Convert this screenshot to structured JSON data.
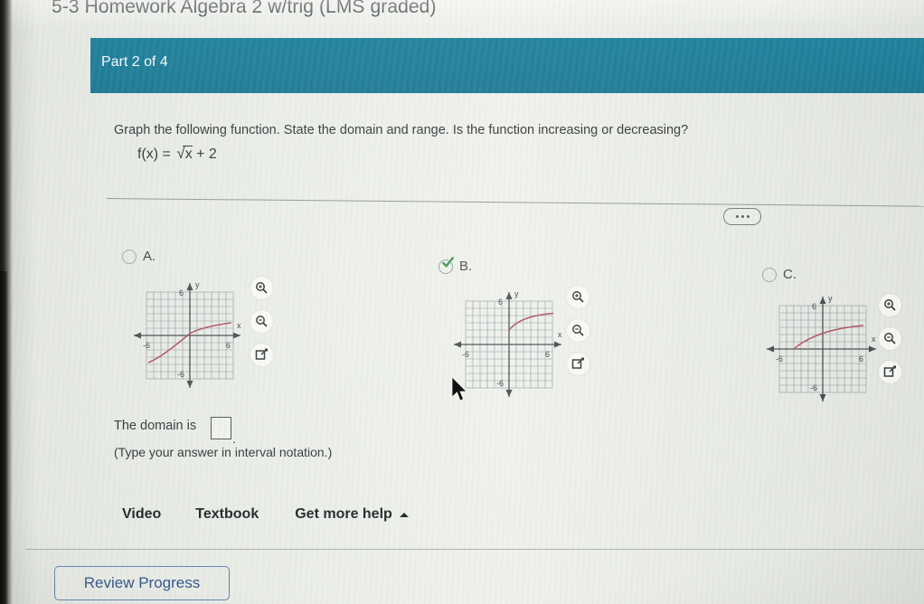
{
  "header": {
    "assignment_title": "5-3 Homework Algebra 2 w/trig (LMS graded)",
    "part_label": "Part 2 of 4"
  },
  "question": {
    "prompt": "Graph the following function. State the domain and range. Is the function increasing or decreasing?",
    "function_prefix": "f(x) =",
    "function_radicand": "x",
    "function_suffix": "+ 2",
    "more_options_icon": "ellipsis-icon"
  },
  "options": [
    {
      "id": "A",
      "label": "A.",
      "selected": false,
      "graph": {
        "x_axis_label": "x",
        "y_axis_label": "y",
        "x_max_tick": "6",
        "x_min_tick": "-6",
        "y_max_tick": "6",
        "y_min_tick": "-6",
        "curve_type": "cube-root-increasing"
      },
      "tools": [
        "zoom-in-icon",
        "zoom-out-icon",
        "expand-icon"
      ]
    },
    {
      "id": "B",
      "label": "B.",
      "selected": true,
      "graph": {
        "x_axis_label": "x",
        "y_axis_label": "y",
        "x_max_tick": "6",
        "x_min_tick": "-6",
        "y_max_tick": "6",
        "y_min_tick": "-6",
        "curve_type": "square-root-shift-up-2"
      },
      "tools": [
        "zoom-in-icon",
        "zoom-out-icon",
        "expand-icon"
      ]
    },
    {
      "id": "C",
      "label": "C.",
      "selected": false,
      "graph": {
        "x_axis_label": "x",
        "y_axis_label": "y",
        "x_max_tick": "6",
        "x_min_tick": "-6",
        "y_max_tick": "6",
        "y_min_tick": "-6",
        "curve_type": "square-root-shift-left-4"
      },
      "tools": [
        "zoom-in-icon",
        "zoom-out-icon",
        "expand-icon"
      ]
    }
  ],
  "answer": {
    "domain_label": "The domain is",
    "domain_value": "",
    "domain_period": ".",
    "hint": "(Type your answer in interval notation.)"
  },
  "help": {
    "video_label": "Video",
    "textbook_label": "Textbook",
    "get_more_help_label": "Get more help",
    "caret_icon": "caret-up-icon"
  },
  "footer": {
    "review_progress_label": "Review Progress"
  },
  "colors": {
    "part_bar": "#1d7c98",
    "curve": "#a8485a",
    "grid": "#7d8b93",
    "review_border": "#5d7fae",
    "review_text": "#2f4f86",
    "check_green": "#2f8f3e"
  }
}
